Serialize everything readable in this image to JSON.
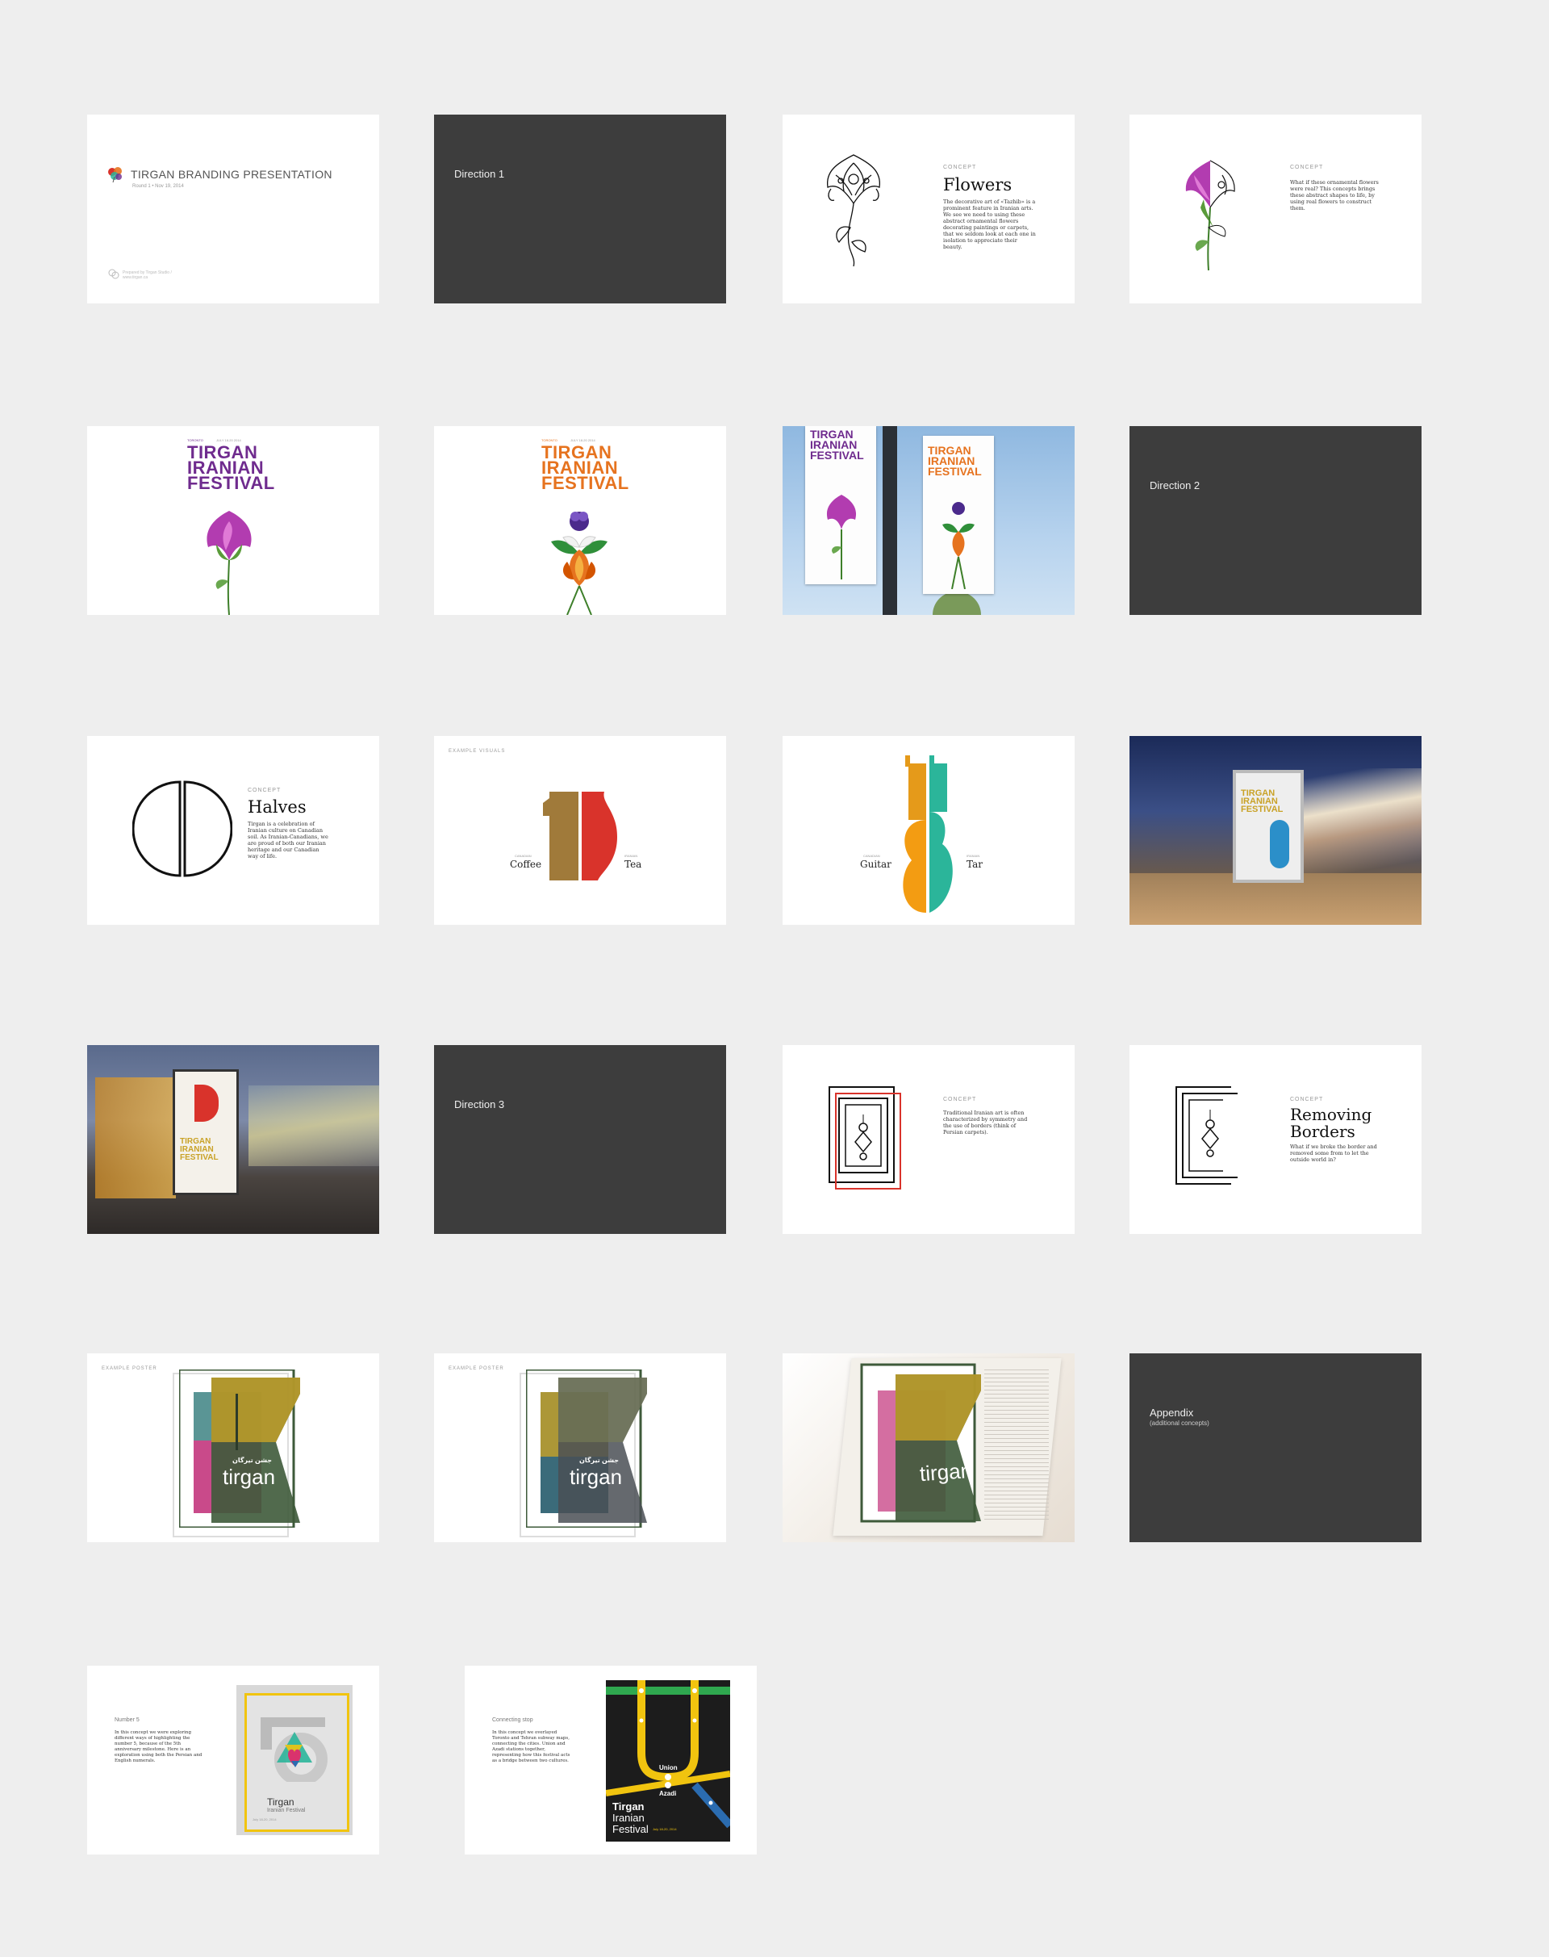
{
  "colors": {
    "background": "#eeeeee",
    "dark_slide": "#3d3d3d",
    "purple": "#6f2b8e",
    "orange": "#e6731f",
    "gold": "#c9a227",
    "teal": "#2bb59a",
    "brown": "#a07a3a",
    "red": "#d9332b"
  },
  "title_slide": {
    "title": "TIRGAN BRANDING PRESENTATION",
    "subtitle": "Round 1 • Nov 19, 2014",
    "footer": "Prepared by Tirgan Studio / www.tirgan.ca"
  },
  "directions": {
    "d1": "Direction 1",
    "d2": "Direction 2",
    "d3": "Direction 3",
    "appendix": "Appendix",
    "appendix_sub": "(additional concepts)"
  },
  "flowers": {
    "kicker": "CONCEPT",
    "heading": "Flowers",
    "body": "The decorative art of «Tazhib» is a prominent feature in Iranian arts. We see we need to using these abstract ornamental flowers decorating paintings or carpets, that we seldom look at each one in isolation to appreciate their beauty."
  },
  "flowers2": {
    "kicker": "CONCEPT",
    "body": "What if these ornamental flowers were real? This concepts brings these abstract shapes to life, by using real flowers to construct them."
  },
  "poster": {
    "meta_left": "TORONTO",
    "meta_right": "JULY 18-20 2014",
    "line1": "TIRGAN",
    "line2": "IRANIAN",
    "line3": "FESTIVAL"
  },
  "halves": {
    "kicker": "CONCEPT",
    "heading": "Halves",
    "body": "Tirgan is a celebration of Iranian culture on Canadian soil. As Iranian-Canadians, we are proud of both our Iranian heritage and our Canadian way of life."
  },
  "examples": {
    "label": "EXAMPLE VISUALS",
    "coffee_small": "CANADIAN",
    "coffee": "Coffee",
    "tea_small": "IRANIAN",
    "tea": "Tea",
    "guitar_small": "CANADIAN",
    "guitar": "Guitar",
    "tar_small": "IRANIAN",
    "tar": "Tar"
  },
  "borders": {
    "kicker": "CONCEPT",
    "body": "Traditional Iranian art is often characterized by symmetry and the use of borders (think of Persian carpets).",
    "kicker2": "CONCEPT",
    "heading": "Removing Borders",
    "body2": "What if we broke the border and removed some from to let the outside world in?"
  },
  "example_poster": {
    "label": "EXAMPLE POSTER",
    "word": "tirgan",
    "persian_date": "جشن تیرگان"
  },
  "number5": {
    "label": "Number 5",
    "body": "In this concept we were exploring different ways of highlighting the number 5, because of the 5th anniversary milestone. Here is an exploration using both the Persian and English numerals.",
    "poster_title": "Tirgan",
    "poster_sub": "Iranian Festival",
    "poster_meta": "July 18-20, 2014"
  },
  "connecting": {
    "label": "Connecting stop",
    "body": "In this concept we overlayed Toronto and Tehran subway maps, connecting the cities. Union and Azadi stations together, representing how this festival acts as a bridge between two cultures.",
    "station1": "Union",
    "station2": "Azadi",
    "t1": "Tirgan",
    "t2": "Iranian",
    "t3": "Festival",
    "meta": "July 18-20, 2014"
  }
}
